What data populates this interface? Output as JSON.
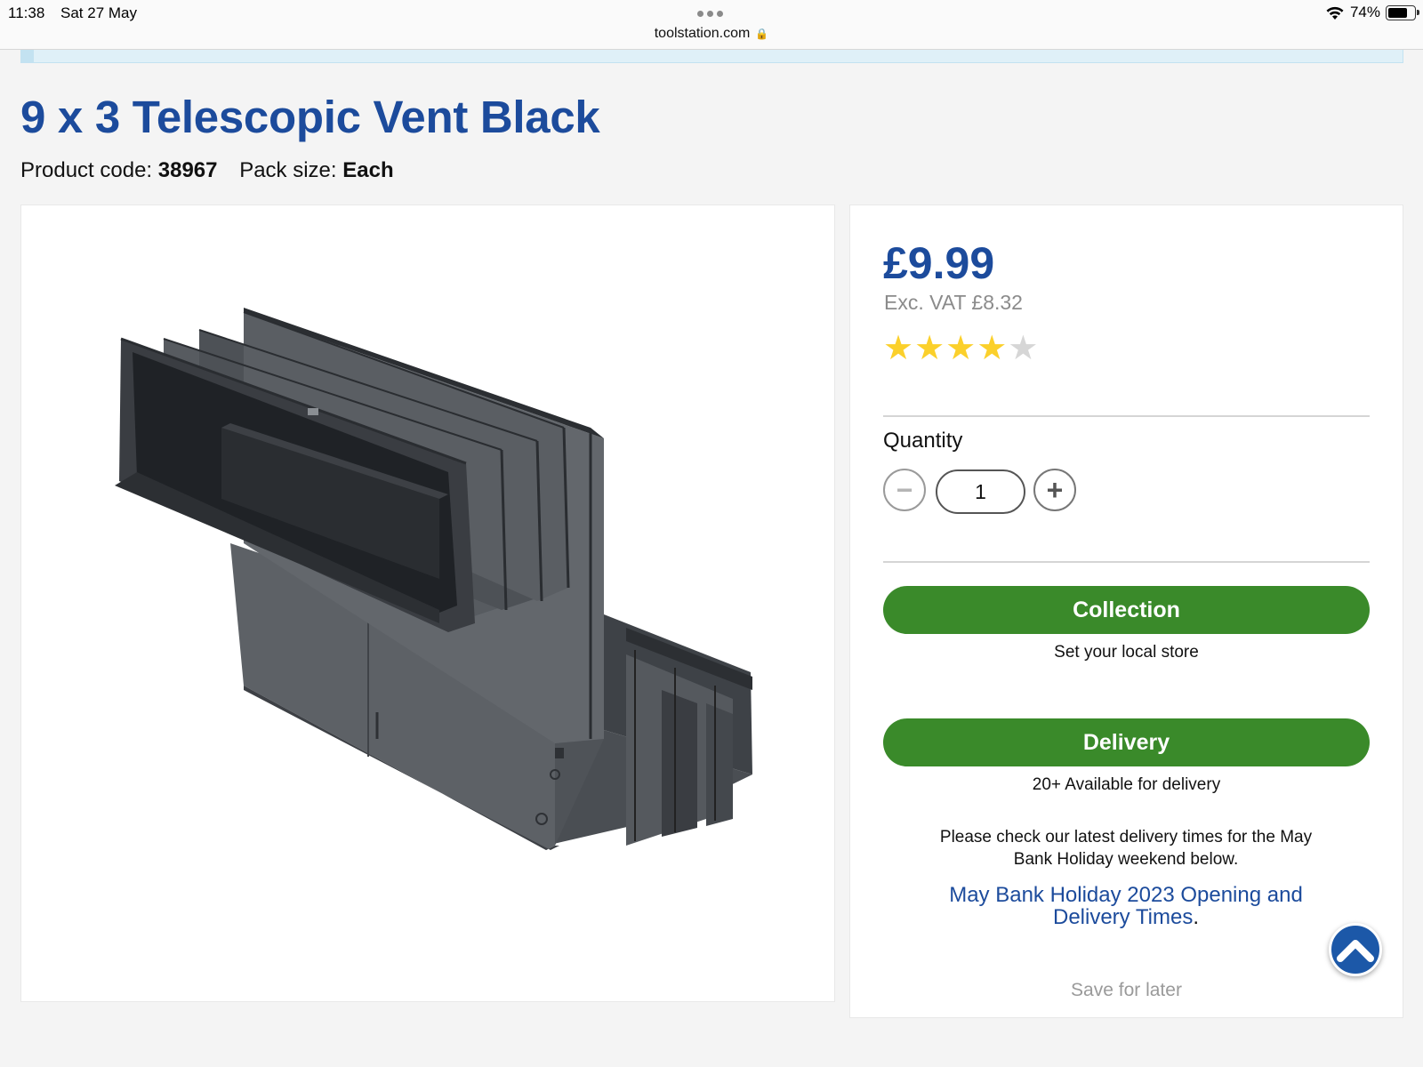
{
  "status_bar": {
    "time": "11:38",
    "date": "Sat 27 May",
    "url": "toolstation.com",
    "battery": "74%",
    "battery_level": 0.74
  },
  "product": {
    "title": "9 x 3 Telescopic Vent Black",
    "code_label": "Product code:",
    "code": "38967",
    "pack_label": "Pack size:",
    "pack": "Each",
    "image_icon": "vent-product-image"
  },
  "buy": {
    "price": "£9.99",
    "exc_vat": "Exc. VAT £8.32",
    "rating": 4,
    "rating_max": 5,
    "star_color": "#fbd02b",
    "quantity_label": "Quantity",
    "quantity_value": "1",
    "collection_label": "Collection",
    "collection_sub": "Set your local store",
    "delivery_label": "Delivery",
    "delivery_sub": "20+ Available for delivery",
    "notice": "Please check our latest delivery times for the May Bank Holiday weekend below.",
    "notice_link": "May Bank Holiday 2023 Opening and Delivery Times",
    "notice_link_suffix": ".",
    "save_later": "Save for later",
    "button_color": "#3a8a2a",
    "brand_color": "#1c4b9c"
  }
}
